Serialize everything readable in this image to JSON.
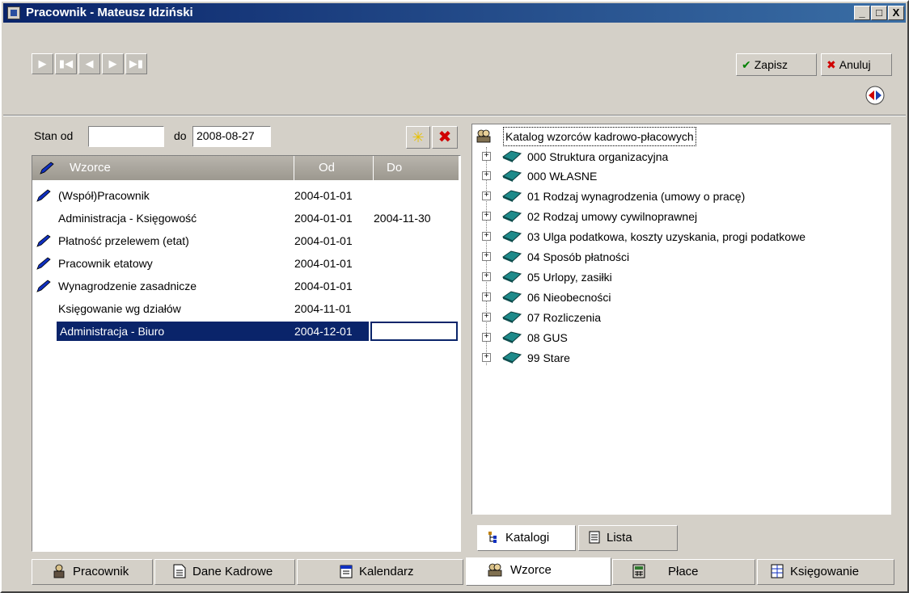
{
  "window": {
    "title": "Pracownik - Mateusz Idziński",
    "min_label": "_",
    "max_label": "□",
    "close_label": "X"
  },
  "toolbar": {
    "save_label": "Zapisz",
    "cancel_label": "Anuluj"
  },
  "filter": {
    "from_label": "Stan od",
    "from_value": "",
    "to_label": "do",
    "to_value": "2008-08-27"
  },
  "grid": {
    "columns": [
      "Wzorce",
      "Od",
      "Do"
    ],
    "rows": [
      {
        "name": "(Współ)Pracownik",
        "from": "2004-01-01",
        "to": "",
        "pen": true
      },
      {
        "name": "Administracja - Księgowość",
        "from": "2004-01-01",
        "to": "2004-11-30",
        "pen": false
      },
      {
        "name": "Płatność przelewem (etat)",
        "from": "2004-01-01",
        "to": "",
        "pen": true
      },
      {
        "name": "Pracownik etatowy",
        "from": "2004-01-01",
        "to": "",
        "pen": true
      },
      {
        "name": "Wynagrodzenie zasadnicze",
        "from": "2004-01-01",
        "to": "",
        "pen": true
      },
      {
        "name": "Księgowanie wg działów",
        "from": "2004-11-01",
        "to": "",
        "pen": false
      },
      {
        "name": "Administracja - Biuro",
        "from": "2004-12-01",
        "to": "",
        "pen": false,
        "selected": true
      }
    ]
  },
  "tree": {
    "root": "Katalog wzorców kadrowo-płacowych",
    "items": [
      "000 Struktura organizacyjna",
      "000 WŁASNE",
      "01 Rodzaj wynagrodzenia (umowy o pracę)",
      "02 Rodzaj umowy cywilnoprawnej",
      "03 Ulga podatkowa, koszty uzyskania, progi podatkowe",
      "04 Sposób płatności",
      "05 Urlopy, zasiłki",
      "06 Nieobecności",
      "07 Rozliczenia",
      "08 GUS",
      "99 Stare"
    ]
  },
  "subtabs": [
    "Katalogi",
    "Lista"
  ],
  "tabs": [
    "Pracownik",
    "Dane Kadrowe",
    "Kalendarz",
    "Wzorce",
    "Płace",
    "Księgowanie"
  ],
  "colors": {
    "title_start": "#0a246a",
    "title_end": "#3a6ea5",
    "selection": "#0a246a",
    "book": "#1e8a8a",
    "cancel_x": "#d00000",
    "save_check": "#008000"
  }
}
